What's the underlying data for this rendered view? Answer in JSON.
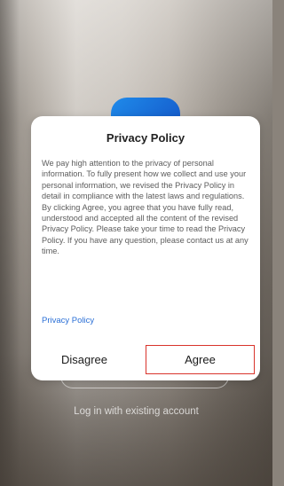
{
  "dialog": {
    "title": "Privacy Policy",
    "body": "We pay high attention to the privacy of personal information. To fully present how we collect and use your personal information, we revised the Privacy Policy in detail in compliance with the latest laws and regulations. By clicking Agree, you agree that you have fully read, understood and accepted all the content of the revised Privacy Policy. Please take your time to read the Privacy Policy. If you have any question, please contact us at any time.",
    "link_label": "Privacy Policy",
    "disagree_label": "Disagree",
    "agree_label": "Agree"
  },
  "background": {
    "existing_account_label": "Log in with existing account"
  },
  "colors": {
    "link": "#2a6fd6",
    "highlight_border": "#d9342b",
    "logo_blue": "#1f8bea"
  }
}
